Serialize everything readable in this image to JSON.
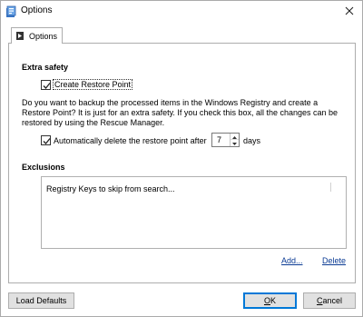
{
  "window": {
    "title": "Options",
    "icon": "app-icon",
    "close_icon": "close-icon"
  },
  "tabs": [
    {
      "label": "Options",
      "icon": "options-tab-icon",
      "selected": true
    }
  ],
  "extra_safety": {
    "heading": "Extra safety",
    "create_restore_point": {
      "label": "Create Restore Point",
      "checked": true
    },
    "description": "Do you want to backup the processed items in the Windows Registry and create a Restore Point? It is just for an extra safety. If you check this box, all the changes can be restored by using the Rescue Manager.",
    "auto_delete": {
      "label": "Automatically delete the restore point after",
      "checked": true,
      "days_value": "7",
      "unit": "days"
    }
  },
  "exclusions": {
    "heading": "Exclusions",
    "list_placeholder": "Registry Keys to skip from search...",
    "add_link": "Add...",
    "delete_link": "Delete"
  },
  "footer": {
    "load_defaults": "Load Defaults",
    "ok": "OK",
    "cancel": "Cancel"
  },
  "colors": {
    "accent": "#0078d7",
    "link": "#0b3b94",
    "button_face": "#e1e1e1"
  }
}
